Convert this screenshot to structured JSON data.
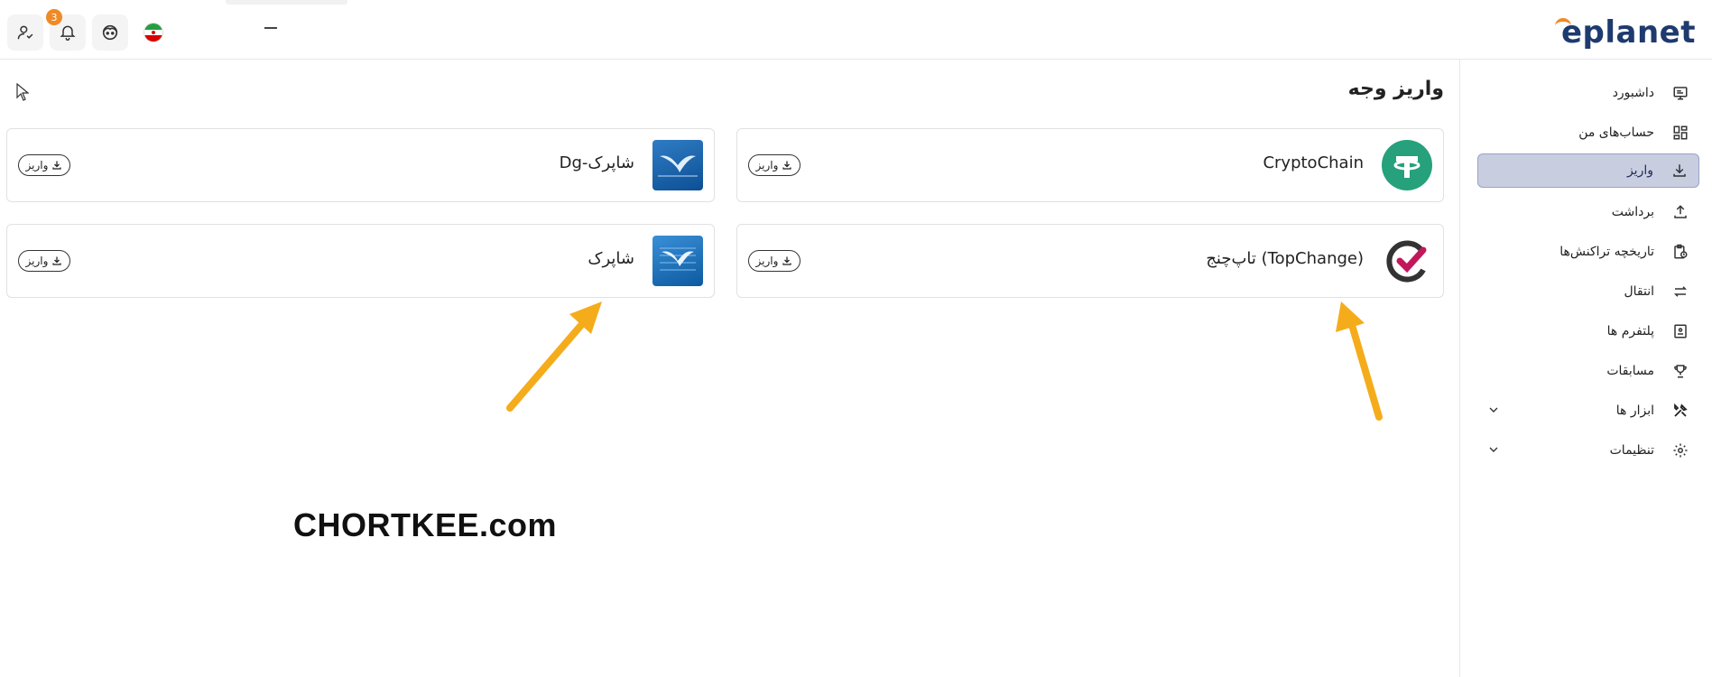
{
  "header": {
    "logo_text": "eplanet",
    "notification_count": "3",
    "language_flag": "iran-flag"
  },
  "sidebar": {
    "items": [
      {
        "label": "داشبورد",
        "icon": "monitor-icon"
      },
      {
        "label": "حساب‌های من",
        "icon": "grid-icon"
      },
      {
        "label": "واریز",
        "icon": "download-icon",
        "active": true
      },
      {
        "label": "برداشت",
        "icon": "upload-icon"
      },
      {
        "label": "تاریخچه تراکنش‌ها",
        "icon": "clipboard-clock-icon"
      },
      {
        "label": "انتقال",
        "icon": "transfer-arrows-icon"
      },
      {
        "label": "پلتفرم ها",
        "icon": "platform-icon"
      },
      {
        "label": "مسابقات",
        "icon": "trophy-icon"
      },
      {
        "label": "ابزار ها",
        "icon": "tools-icon",
        "expandable": true
      },
      {
        "label": "تنظیمات",
        "icon": "gear-icon",
        "expandable": true
      }
    ]
  },
  "main": {
    "title": "واریز وجه",
    "methods": [
      {
        "name": "CryptoChain",
        "button": "واریز",
        "logo": "tether-logo"
      },
      {
        "name": "Dg-شاپرک",
        "button": "واریز",
        "logo": "shaparak-logo"
      },
      {
        "name": "تاپ‌چنج (TopChange)",
        "button": "واریز",
        "logo": "topchange-logo"
      },
      {
        "name": "شاپرک",
        "button": "واریز",
        "logo": "shaparak-logo"
      }
    ]
  },
  "watermark": "CHORTKEE.com",
  "colors": {
    "accent": "#f08a24",
    "brand": "#1e3a6e",
    "active_nav": "#c8cde0",
    "tether": "#26a17b",
    "arrow": "#f5ac1b"
  }
}
